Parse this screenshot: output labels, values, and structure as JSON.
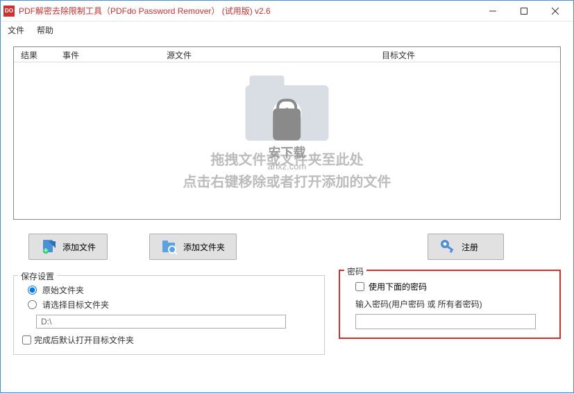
{
  "window": {
    "icon_text": "DO",
    "title": "PDF解密去除限制工具（PDFdo Password Remover） (试用版) v2.6"
  },
  "menu": {
    "file": "文件",
    "help": "帮助"
  },
  "columns": {
    "result": "结果",
    "event": "事件",
    "source": "源文件",
    "target": "目标文件"
  },
  "placeholder": {
    "line1": "拖拽文件或文件夹至此处",
    "line2": "点击右键移除或者打开添加的文件"
  },
  "watermark": {
    "name": "安下载",
    "url": "anxz.com"
  },
  "buttons": {
    "add_file": "添加文件",
    "add_folder": "添加文件夹",
    "register": "注册"
  },
  "save": {
    "legend": "保存设置",
    "radio_original": "原始文件夹",
    "radio_select": "请选择目标文件夹",
    "path": "D:\\",
    "check_open": "完成后默认打开目标文件夹"
  },
  "password": {
    "legend": "密码",
    "use_below": "使用下面的密码",
    "enter_label": "输入密码(用户密码 或 所有者密码)",
    "value": ""
  }
}
